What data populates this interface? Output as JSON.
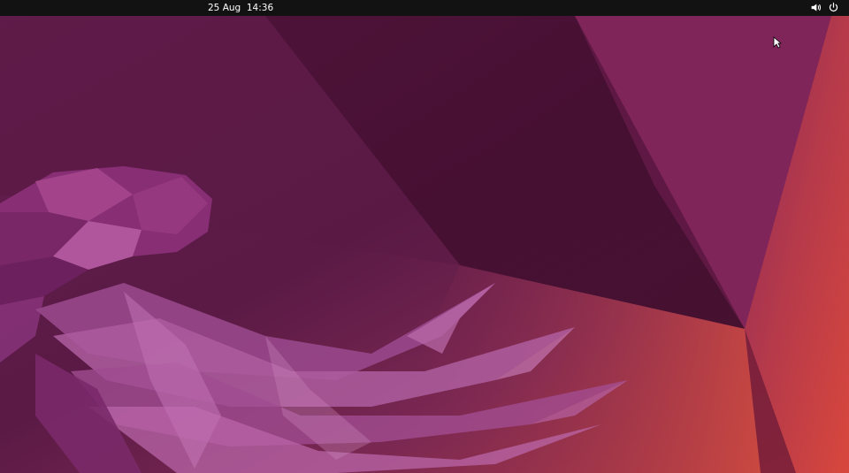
{
  "top_bar": {
    "datetime": "25 Aug  14:36",
    "tray": {
      "volume_icon": "speaker-volume-icon",
      "power_icon": "power-icon"
    }
  },
  "desktop": {
    "wallpaper": "jellyfish-low-poly",
    "colors": {
      "top_bar": "#121212",
      "base": "#5c1a45",
      "dark": "#3f0d2e",
      "accent_orange": "#d5443c",
      "jellyfish_pink": "#b75aa6"
    }
  }
}
